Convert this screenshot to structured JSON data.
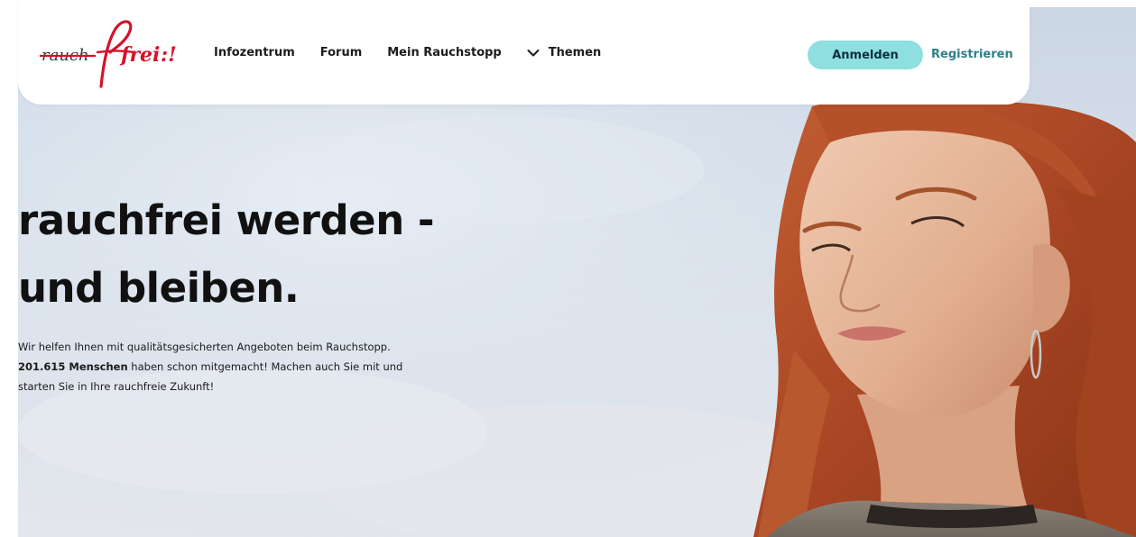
{
  "brand": {
    "logo_strike_text": "rauch",
    "logo_script_text": "frei",
    "logo_suffix_text": ":!",
    "colors": {
      "logo_red": "#d4122b",
      "logo_grey": "#3a3a3a"
    }
  },
  "nav": {
    "items": [
      {
        "label": "Infozentrum"
      },
      {
        "label": "Forum"
      },
      {
        "label": "Mein Rauchstopp"
      }
    ],
    "themes_label": "Themen",
    "themes_icon": "chevron-down-icon",
    "login_label": "Anmelden",
    "register_label": "Registrieren"
  },
  "hero": {
    "headline_line1": "rauchfrei werden -",
    "headline_line2": "und bleiben.",
    "intro_line1": "Wir helfen Ihnen mit qualitätsgesicherten Angeboten beim Rauchstopp.",
    "participants_count": "201.615 Menschen",
    "intro_line2_rest": " haben schon mitgemacht! Machen auch Sie mit und",
    "intro_line3": "starten Sie in Ihre rauchfreie Zukunft!",
    "colors": {
      "sky": "#d6dfea",
      "hair": "#b9542f",
      "skin": "#e6b89d",
      "button_accent": "#8ddfe0"
    }
  }
}
